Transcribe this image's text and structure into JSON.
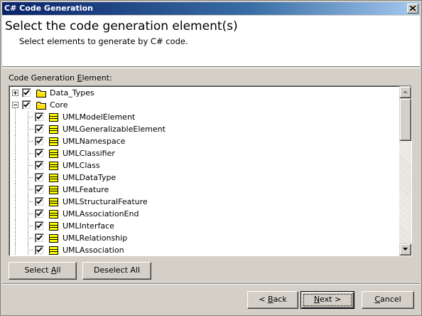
{
  "window": {
    "title": "C# Code Generation"
  },
  "header": {
    "title": "Select the code generation element(s)",
    "subtitle": "Select elements to generate by C# code."
  },
  "section": {
    "label_pre": "Code Generation ",
    "label_accel": "E",
    "label_post": "lement:"
  },
  "tree": {
    "items": [
      {
        "label": "Data_Types",
        "level": 0,
        "expander": "plus",
        "checked": true,
        "icon": "folder-icon"
      },
      {
        "label": "Core",
        "level": 0,
        "expander": "minus",
        "checked": true,
        "icon": "folder-icon"
      },
      {
        "label": "UMLModelElement",
        "level": 1,
        "checked": true,
        "icon": "class-icon"
      },
      {
        "label": "UMLGeneralizableElement",
        "level": 1,
        "checked": true,
        "icon": "class-icon"
      },
      {
        "label": "UMLNamespace",
        "level": 1,
        "checked": true,
        "icon": "class-icon"
      },
      {
        "label": "UMLClassifier",
        "level": 1,
        "checked": true,
        "icon": "class-icon"
      },
      {
        "label": "UMLClass",
        "level": 1,
        "checked": true,
        "icon": "class-icon"
      },
      {
        "label": "UMLDataType",
        "level": 1,
        "checked": true,
        "icon": "class-icon"
      },
      {
        "label": "UMLFeature",
        "level": 1,
        "checked": true,
        "icon": "class-icon"
      },
      {
        "label": "UMLStructuralFeature",
        "level": 1,
        "checked": true,
        "icon": "class-icon"
      },
      {
        "label": "UMLAssociationEnd",
        "level": 1,
        "checked": true,
        "icon": "class-icon"
      },
      {
        "label": "UMLInterface",
        "level": 1,
        "checked": true,
        "icon": "class-icon"
      },
      {
        "label": "UMLRelationship",
        "level": 1,
        "checked": true,
        "icon": "class-icon"
      },
      {
        "label": "UMLAssociation",
        "level": 1,
        "checked": true,
        "icon": "class-icon"
      }
    ]
  },
  "buttons": {
    "select_all": {
      "pre": "Select ",
      "accel": "A",
      "post": "ll"
    },
    "deselect_all": {
      "pre": "Deselect All",
      "accel": "",
      "post": ""
    },
    "back": {
      "pre": "< ",
      "accel": "B",
      "post": "ack"
    },
    "next": {
      "pre": "",
      "accel": "N",
      "post": "ext >"
    },
    "cancel": {
      "pre": "",
      "accel": "C",
      "post": "ancel"
    }
  },
  "colors": {
    "title_start": "#0a246a",
    "title_end": "#a6caf0",
    "dialog_bg": "#d4d0c8",
    "folder_yellow": "#ffe000",
    "class_yellow": "#ffff00"
  }
}
